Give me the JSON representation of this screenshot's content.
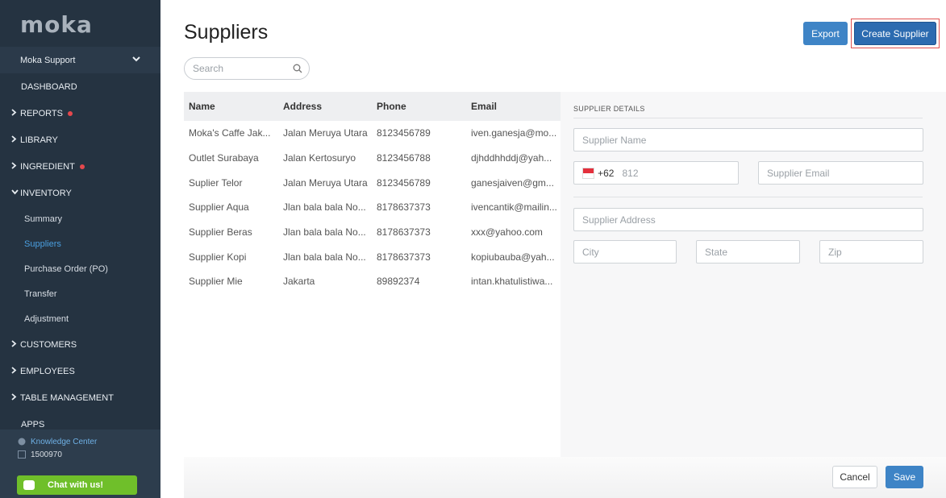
{
  "sidebar": {
    "logo": "moka",
    "account": "Moka Support",
    "nav": [
      {
        "label": "DASHBOARD",
        "arrow": "",
        "dot": false
      },
      {
        "label": "REPORTS",
        "arrow": "›",
        "dot": true
      },
      {
        "label": "LIBRARY",
        "arrow": "›",
        "dot": false
      },
      {
        "label": "INGREDIENT",
        "arrow": "›",
        "dot": true
      },
      {
        "label": "INVENTORY",
        "arrow": "⌄",
        "dot": false
      }
    ],
    "inventory_sub": [
      "Summary",
      "Suppliers",
      "Purchase Order (PO)",
      "Transfer",
      "Adjustment"
    ],
    "nav_after": [
      {
        "label": "CUSTOMERS",
        "arrow": "›"
      },
      {
        "label": "EMPLOYEES",
        "arrow": "›"
      },
      {
        "label": "TABLE MANAGEMENT",
        "arrow": "›"
      },
      {
        "label": "APPS",
        "arrow": ""
      }
    ],
    "knowledge_center": "Knowledge Center",
    "phone": "1500970",
    "chat": "Chat with us!"
  },
  "header": {
    "title": "Suppliers",
    "export": "Export",
    "create": "Create Supplier"
  },
  "search": {
    "placeholder": "Search"
  },
  "table": {
    "headers": [
      "Name",
      "Address",
      "Phone",
      "Email"
    ],
    "rows": [
      [
        "Moka's Caffe Jak...",
        "Jalan Meruya Utara",
        "8123456789",
        "iven.ganesja@mo..."
      ],
      [
        "Outlet Surabaya",
        "Jalan Kertosuryo",
        "8123456788",
        "djhddhhddj@yah..."
      ],
      [
        "Suplier Telor",
        "Jalan Meruya Utara",
        "8123456789",
        "ganesjaiven@gm..."
      ],
      [
        "Supplier Aqua",
        "Jlan bala bala No...",
        "8178637373",
        "ivencantik@mailin..."
      ],
      [
        "Supplier Beras",
        "Jlan bala bala No...",
        "8178637373",
        "xxx@yahoo.com"
      ],
      [
        "Supplier Kopi",
        "Jlan bala bala No...",
        "8178637373",
        "kopiubauba@yah..."
      ],
      [
        "Supplier Mie",
        "Jakarta",
        "89892374",
        "intan.khatulistiwa..."
      ]
    ]
  },
  "details": {
    "title": "SUPPLIER DETAILS",
    "name_placeholder": "Supplier Name",
    "country_code": "+62",
    "phone_placeholder": "812",
    "email_placeholder": "Supplier Email",
    "address_placeholder": "Supplier Address",
    "city_placeholder": "City",
    "state_placeholder": "State",
    "zip_placeholder": "Zip"
  },
  "footer": {
    "cancel": "Cancel",
    "save": "Save"
  },
  "colors": {
    "sidebar": "#253341",
    "accent": "#3e84c6",
    "active_link": "#4a9fe0",
    "chat": "#6fbf2a"
  }
}
